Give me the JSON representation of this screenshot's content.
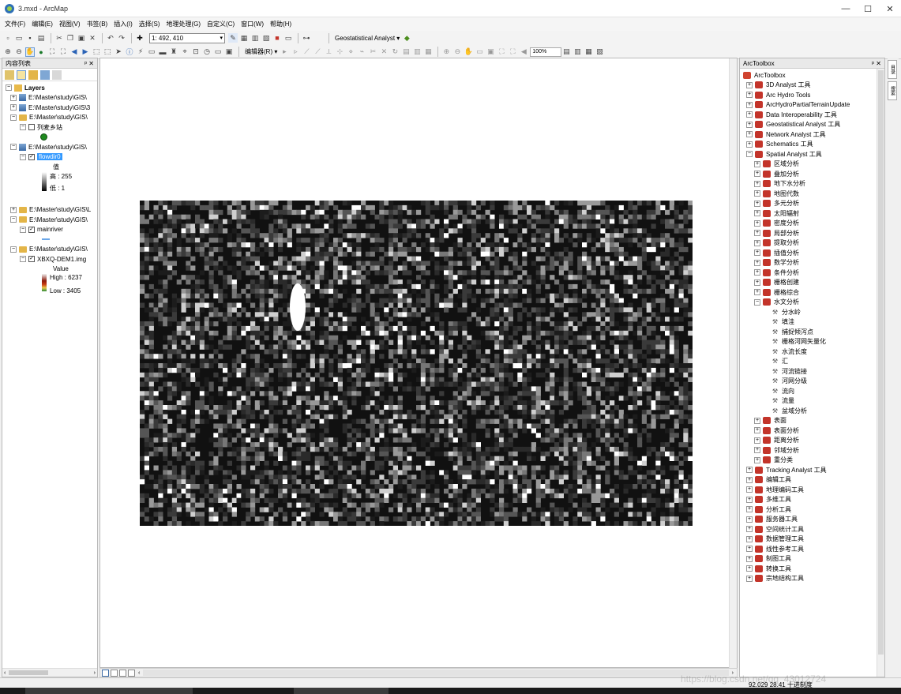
{
  "window": {
    "title": "3.mxd - ArcMap",
    "min": "—",
    "max": "☐",
    "close": "✕"
  },
  "menu": [
    "文件(F)",
    "编辑(E)",
    "视图(V)",
    "书签(B)",
    "插入(I)",
    "选择(S)",
    "地理处理(G)",
    "自定义(C)",
    "窗口(W)",
    "帮助(H)"
  ],
  "toolbar": {
    "scale": "1: 492, 410",
    "geostatistical": "Geostatistical Analyst ▾",
    "editor": "编辑器(R) ▾",
    "zoom": "100%"
  },
  "toc": {
    "title": "内容列表",
    "controls": "ᵖ ✕",
    "layers_label": "Layers",
    "items": [
      {
        "label": "E:\\Master\\study\\GIS\\"
      },
      {
        "label": "E:\\Master\\study\\GIS\\3"
      },
      {
        "label": "E:\\Master\\study\\GIS\\"
      },
      {
        "label": "列麦乡站"
      },
      {
        "label": "E:\\Master\\study\\GIS\\"
      },
      {
        "label": "flowdir0"
      },
      {
        "label": "E:\\Master\\study\\GIS\\L"
      },
      {
        "label": "E:\\Master\\study\\GIS\\"
      },
      {
        "label": "mainriver"
      },
      {
        "label": "E:\\Master\\study\\GIS\\"
      },
      {
        "label": "XBXQ-DEM1.img"
      }
    ],
    "flow_legend": {
      "title": "值",
      "high": "高 : 255",
      "low": "低 : 1"
    },
    "dem_legend": {
      "title": "Value",
      "high": "High : 6237",
      "low": "Low : 3405"
    }
  },
  "arctoolbox": {
    "title": "ArcToolbox",
    "controls": "ᵖ ✕",
    "root": "ArcToolbox",
    "top_items": [
      "3D Analyst 工具",
      "Arc Hydro Tools",
      "ArcHydroPartialTerrainUpdate",
      "Data Interoperability 工具",
      "Geostatistical Analyst 工具",
      "Network Analyst 工具",
      "Schematics 工具",
      "Spatial Analyst 工具"
    ],
    "spatial_sub": [
      "区域分析",
      "叠加分析",
      "地下水分析",
      "地图代数",
      "多元分析",
      "太阳辐射",
      "密度分析",
      "局部分析",
      "提取分析",
      "插值分析",
      "数学分析",
      "条件分析",
      "栅格创建",
      "栅格综合",
      "水文分析"
    ],
    "hydro_tools": [
      "分水岭",
      "填洼",
      "捕捉倾泻点",
      "栅格河网矢量化",
      "水流长度",
      "汇",
      "河流链接",
      "河网分级",
      "流向",
      "流量",
      "盆域分析"
    ],
    "spatial_sub2": [
      "表面",
      "表面分析",
      "距离分析",
      "邻域分析",
      "重分类"
    ],
    "bottom_items": [
      "Tracking Analyst 工具",
      "编辑工具",
      "地理编码工具",
      "多维工具",
      "分析工具",
      "服务器工具",
      "空间统计工具",
      "数据管理工具",
      "线性参考工具",
      "制图工具",
      "转换工具",
      "宗地结构工具"
    ]
  },
  "side_tabs": [
    "目录",
    "搜索"
  ],
  "status": {
    "coords": "92.029  28.41 十进制度",
    "watermark": "https://blog.csdn.net/qq_43012724"
  }
}
